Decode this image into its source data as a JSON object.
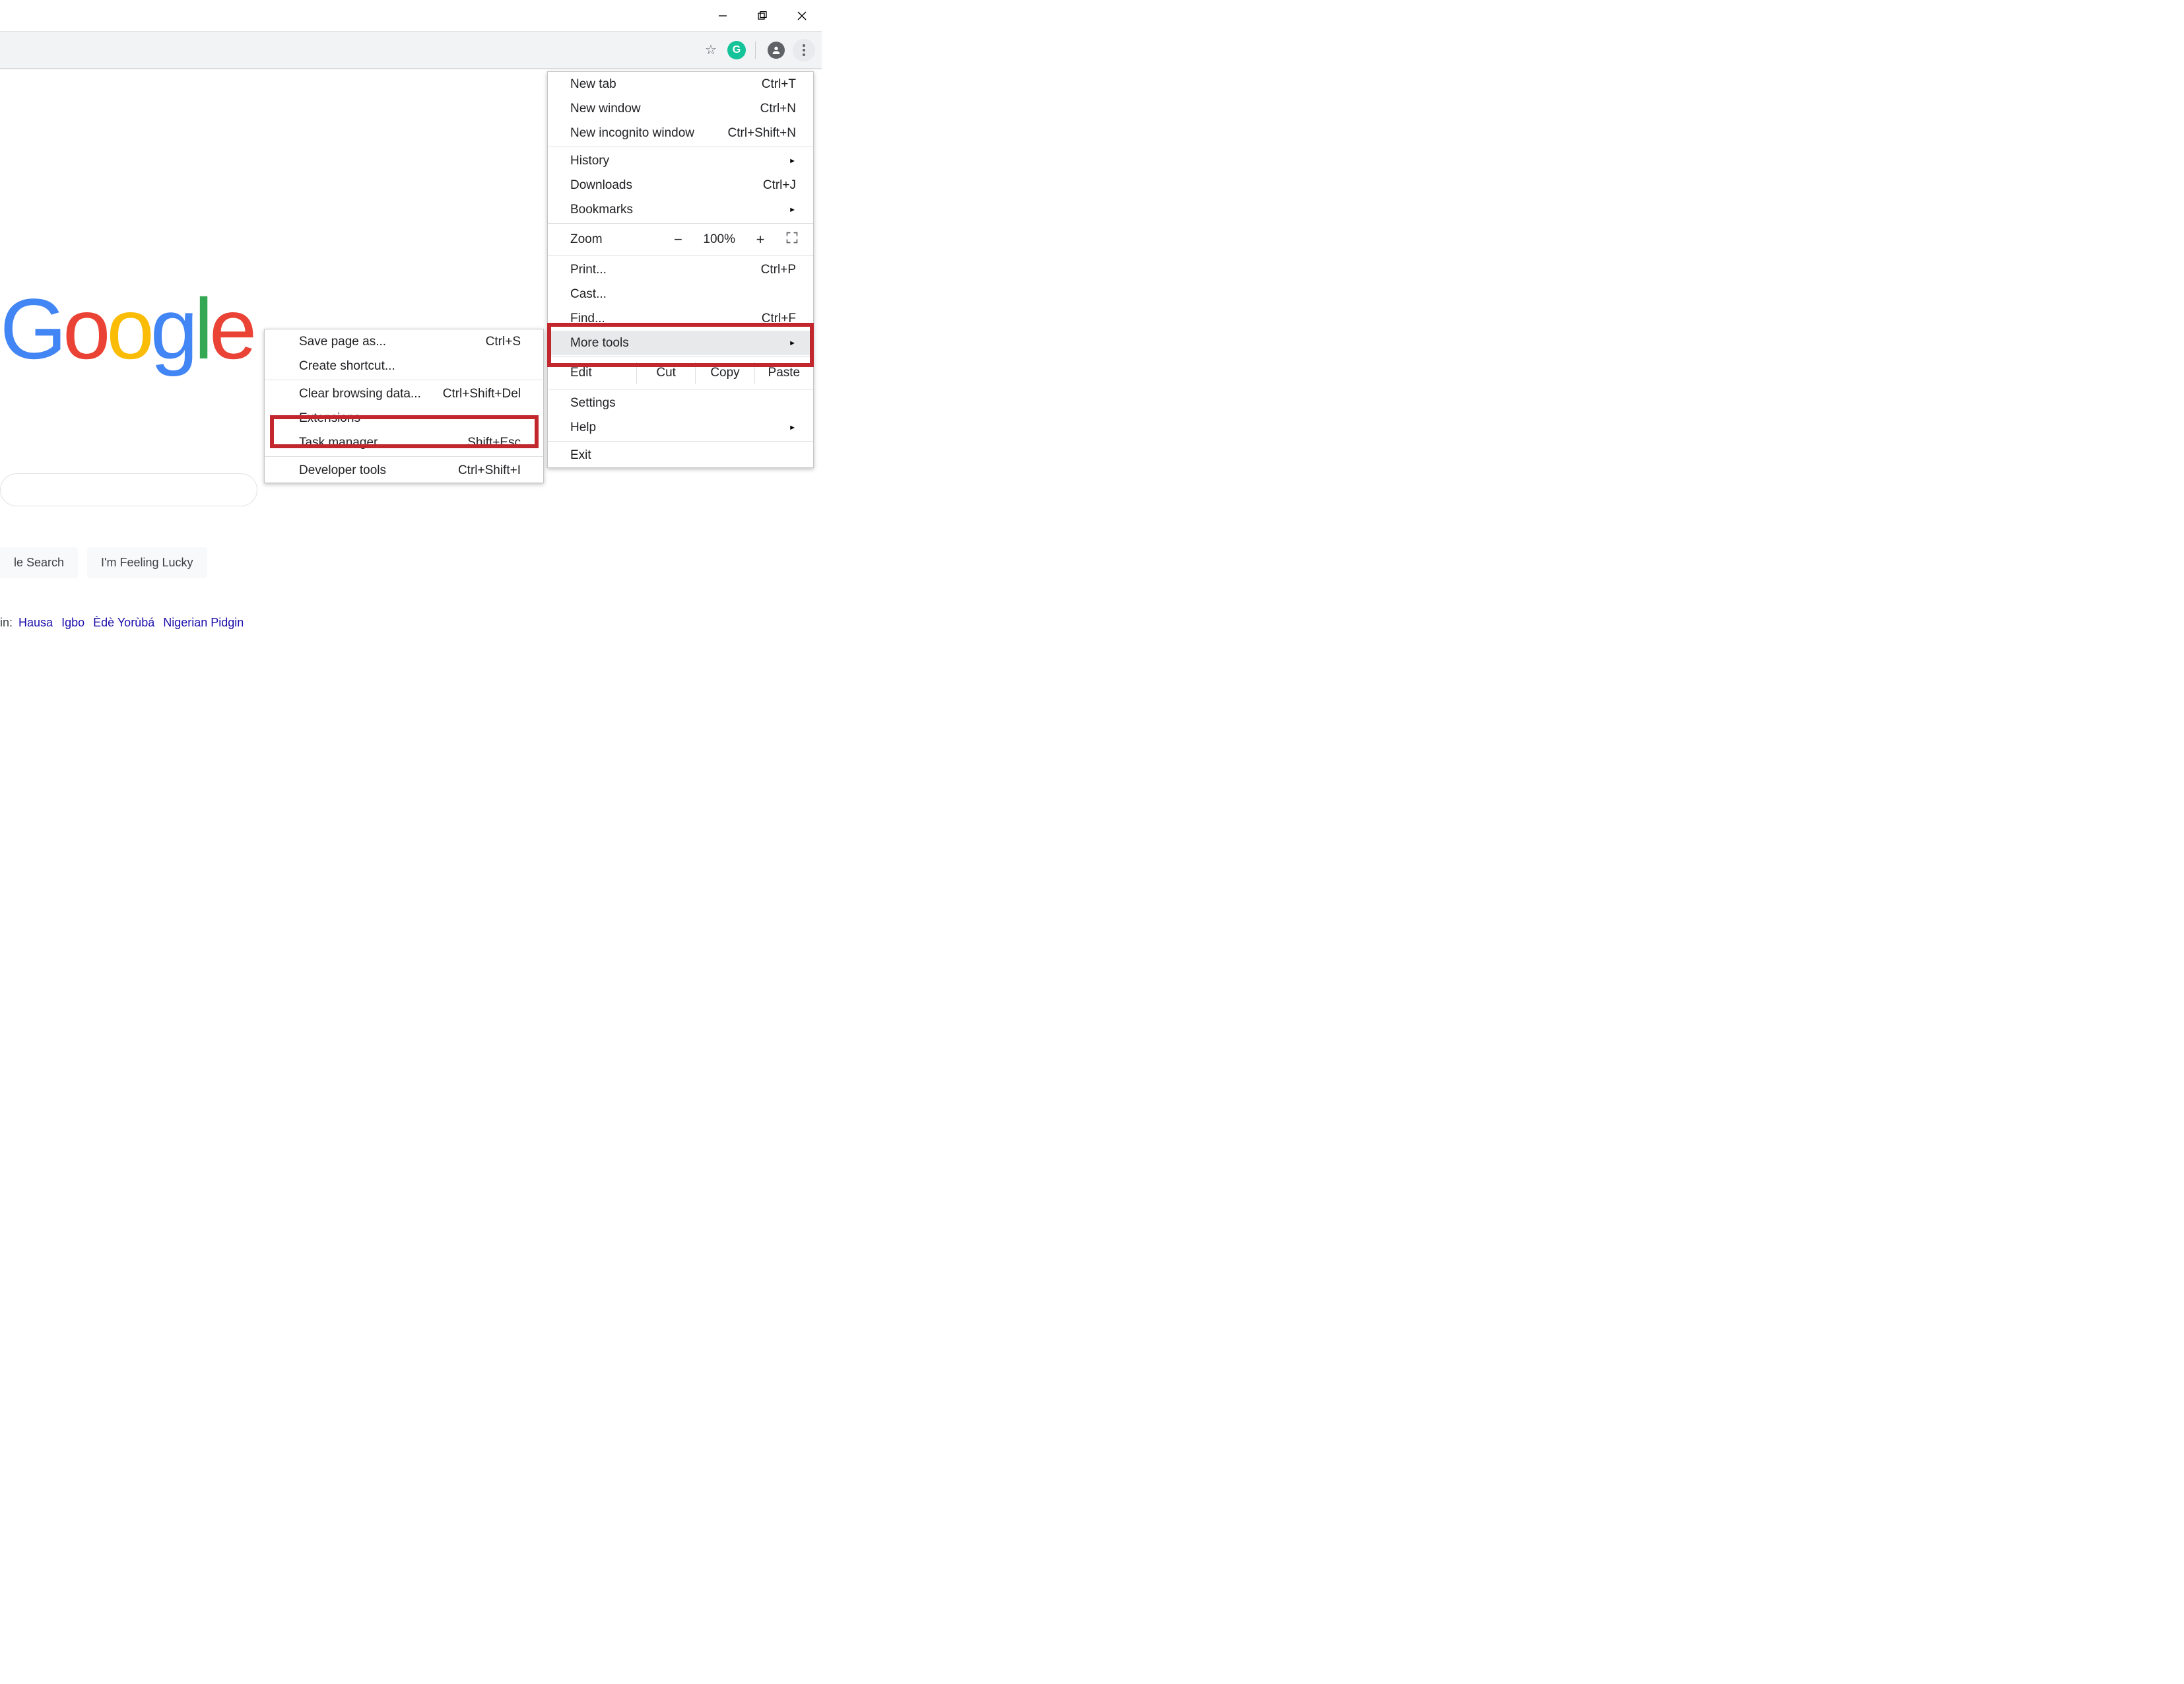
{
  "window": {
    "minimize": "−",
    "maximize": "",
    "close": ""
  },
  "toolbar": {
    "star": "☆",
    "ext_badge": "G"
  },
  "page": {
    "logo": {
      "g1": "G",
      "g2": "o",
      "g3": "o",
      "g4": "g",
      "g5": "l",
      "g6": "e"
    },
    "btn_search": "le Search",
    "btn_lucky": "I'm Feeling Lucky",
    "lang_prefix": "in: ",
    "langs": [
      "Hausa",
      "Igbo",
      "Èdè Yorùbá",
      "Nigerian Pidgin"
    ]
  },
  "menu": {
    "new_tab": "New tab",
    "new_tab_sc": "Ctrl+T",
    "new_window": "New window",
    "new_window_sc": "Ctrl+N",
    "new_incognito": "New incognito window",
    "new_incognito_sc": "Ctrl+Shift+N",
    "history": "History",
    "downloads": "Downloads",
    "downloads_sc": "Ctrl+J",
    "bookmarks": "Bookmarks",
    "zoom_label": "Zoom",
    "zoom_value": "100%",
    "print": "Print...",
    "print_sc": "Ctrl+P",
    "cast": "Cast...",
    "find": "Find...",
    "find_sc": "Ctrl+F",
    "more_tools": "More tools",
    "edit": "Edit",
    "cut": "Cut",
    "copy": "Copy",
    "paste": "Paste",
    "settings": "Settings",
    "help": "Help",
    "exit": "Exit"
  },
  "submenu": {
    "save": "Save page as...",
    "save_sc": "Ctrl+S",
    "shortcut": "Create shortcut...",
    "clear": "Clear browsing data...",
    "clear_sc": "Ctrl+Shift+Del",
    "ext": "Extensions",
    "task": "Task manager",
    "task_sc": "Shift+Esc",
    "dev": "Developer tools",
    "dev_sc": "Ctrl+Shift+I"
  }
}
